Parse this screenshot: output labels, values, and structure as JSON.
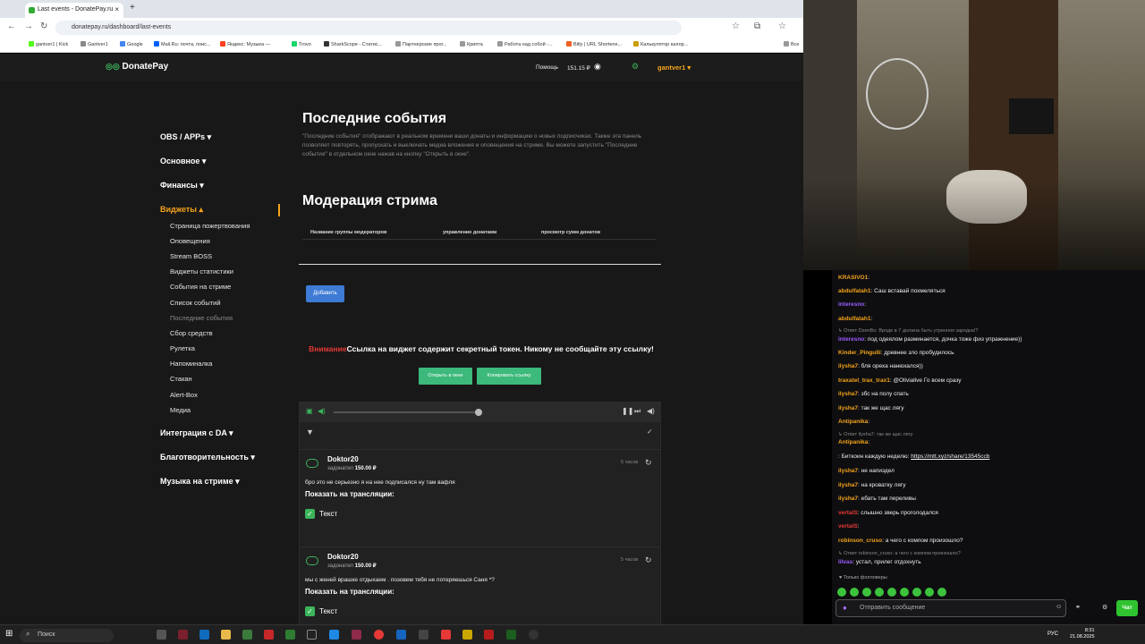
{
  "browser": {
    "tab_title": "Last events - DonatePay.ru",
    "new_tab": "+",
    "url": "donatepay.ru/dashboard/last-events",
    "bookmarks": [
      "gantver1 | Kick",
      "Gantver1",
      "Google",
      "Mail.Ru: почта, поис...",
      "Яндекс: Музыка —",
      "Trovo",
      "SharkScope - Статис...",
      "Партнерские прог...",
      "Крипта",
      "Работа над собой -...",
      "Bitly | URL Shortene...",
      "Калькулятор калор...",
      "Все"
    ]
  },
  "donatepay": {
    "logo": "DonatePay",
    "help": "Помощь",
    "balance": "151.15 ₽",
    "user": "gantver1 ▾",
    "nav": {
      "obs": "OBS / APPs ▾",
      "main": "Основное ▾",
      "finance": "Финансы ▾",
      "widgets": "Виджеты ▴",
      "sub": [
        "Страница пожертвования",
        "Оповещения",
        "Stream BOSS",
        "Виджеты статистики",
        "События на стриме",
        "Список событий",
        "Последние события",
        "Сбор средств",
        "Рулетка",
        "Напоминалка",
        "Стакан",
        "Alert-Box",
        "Медиа"
      ],
      "integration": "Интеграция с DA ▾",
      "charity": "Благотворительность ▾",
      "music": "Музыка на стриме ▾"
    },
    "title": "Последние события",
    "description": "\"Последние события\" отображают в реальном времени ваши донаты и информацию о новых подписчиках. Также эта панель позволяет повторять, пропускать и выключать медиа вложения и оповещения на стриме. Вы можете запустить \"Последние события\" в отдельном окне нажав на кнопку \"Открыть в окне\".",
    "moderation_title": "Модерация стрима",
    "table_headers": [
      "Название группы модераторов",
      "управление донатами",
      "просмотр сумм донатов"
    ],
    "add_button": "Добавить",
    "warning_red": "Внимание",
    "warning_text": "Ссылка на виджет содержит секретный токен. Никому не сообщайте эту ссылку!",
    "open_window": "Открыть в окне",
    "copy_link": "Копировать ссылку",
    "events": [
      {
        "name": "Doktor20",
        "donated_label": "задонатил",
        "amount": "150.00 ₽",
        "time": "5 часов",
        "message": "бро это не серьезно я на нее подписался ну там вафля",
        "show_label": "Показать на трансляции:",
        "option": "Текст"
      },
      {
        "name": "Doktor20",
        "donated_label": "задонатил",
        "amount": "150.00 ₽",
        "time": "5 часов",
        "message": "мы с женей врашке отдыхаем . позовем тебя не потеряешься Саня *?",
        "show_label": "Показать на трансляции:",
        "option": "Текст"
      }
    ]
  },
  "chat": {
    "lines": [
      {
        "user": "KRASIVO1",
        "color": "#f4a31b",
        "text": ":"
      },
      {
        "user": "abdulfatah1",
        "color": "#f4a31b",
        "text": ": Саш вставай похмеляться"
      },
      {
        "user": "interesno",
        "color": "#9b5cff",
        "text": ":"
      },
      {
        "user": "abdulfatah1",
        "color": "#f4a31b",
        "text": ":"
      },
      {
        "sys": "↳ Ответ DzenBo: Вроде в 7 должна быть утренняя зарядка!?"
      },
      {
        "user": "interesno",
        "color": "#9b5cff",
        "text": ": под одеялом разминается, дочка тоже физ упражнение))"
      },
      {
        "user": "Kinder_Pingulli",
        "color": "#f4a31b",
        "text": ": древнее зло пробудилось"
      },
      {
        "user": "ilysha7",
        "color": "#f4a31b",
        "text": ": бля ореха нанюхался))"
      },
      {
        "user": "traxatel_trax_trax1",
        "color": "#f4a31b",
        "text": ": @Olivialive Го всем сразу"
      },
      {
        "user": "ilysha7",
        "color": "#f4a31b",
        "text": ": збс на полу спать"
      },
      {
        "user": "ilysha7",
        "color": "#f4a31b",
        "text": ": так же щас лягу"
      },
      {
        "user": "Antipanika",
        "color": "#f4a31b",
        "text": ":"
      },
      {
        "sys": "↳ Ответ ilysha7: так же щас лягу"
      },
      {
        "user": "Antipanika",
        "color": "#f4a31b",
        "text": ":"
      },
      {
        "user": "",
        "color": "#e53935",
        "text": ": Биткоин каждую неделю: ",
        "link": "https://mtt.xyz/share/13545ccb"
      },
      {
        "user": "ilysha7",
        "color": "#f4a31b",
        "text": ": не напиздел"
      },
      {
        "user": "ilysha7",
        "color": "#f4a31b",
        "text": ": на кроватку лягу"
      },
      {
        "user": "ilysha7",
        "color": "#f4a31b",
        "text": ": ебать там переливы"
      },
      {
        "user": "vertalS",
        "color": "#e53935",
        "text": ": слышно зверь проголодался"
      },
      {
        "user": "vertalS",
        "color": "#e53935",
        "text": ":"
      },
      {
        "user": "robinson_cruso",
        "color": "#f4a31b",
        "text": ": а чего с компом произошло?"
      },
      {
        "sys": "↳ Ответ robinson_cruso: а чего с компом произошло?"
      },
      {
        "user": "lilvas",
        "color": "#9b5cff",
        "text": ": устал, прилег отдохнуть"
      }
    ],
    "followers_only": "♥ Только фолловеры",
    "input_placeholder": "Отправить сообщение",
    "send": "Чат"
  },
  "taskbar": {
    "search": "Поиск",
    "lang": "РУС",
    "time": "8:31",
    "date": "21.08.2025"
  }
}
